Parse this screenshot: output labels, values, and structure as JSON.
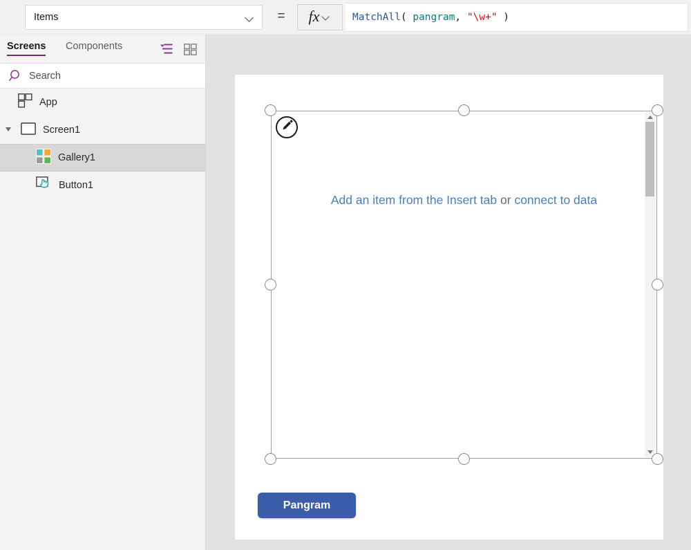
{
  "formula_bar": {
    "property_selector": {
      "value": "Items",
      "chevron_icon": "chevron-down-icon"
    },
    "equals": "=",
    "fx_button": {
      "glyph": "fx",
      "chevron_icon": "chevron-down-icon"
    },
    "formula": {
      "full_text": "MatchAll( pangram, \"\\w+\" )",
      "tokens": [
        {
          "text": "MatchAll",
          "type": "function"
        },
        {
          "text": "( ",
          "type": "punct"
        },
        {
          "text": "pangram",
          "type": "identifier"
        },
        {
          "text": ", ",
          "type": "punct"
        },
        {
          "text": "\"",
          "type": "string"
        },
        {
          "text": "\\w",
          "type": "escape"
        },
        {
          "text": "+\"",
          "type": "string"
        },
        {
          "text": " )",
          "type": "punct"
        }
      ]
    }
  },
  "left_panel": {
    "tabs": [
      {
        "label": "Screens",
        "active": true
      },
      {
        "label": "Components",
        "active": false
      }
    ],
    "view_icons": [
      {
        "name": "tree-view-icon",
        "color": "#8a3a8a"
      },
      {
        "name": "grid-view-icon",
        "color": "#8e8e8e"
      }
    ],
    "search": {
      "placeholder": "Search",
      "value": "",
      "icon": "search-icon"
    },
    "tree_items": [
      {
        "label": "App",
        "icon": "app-icon",
        "indent": 28,
        "selected": false,
        "expander": false
      },
      {
        "label": "Screen1",
        "icon": "screen-icon",
        "indent": 30,
        "selected": false,
        "expander": true
      },
      {
        "label": "Gallery1",
        "icon": "gallery-icon",
        "indent": 52,
        "selected": true,
        "expander": false
      },
      {
        "label": "Button1",
        "icon": "button-icon",
        "indent": 52,
        "selected": false,
        "expander": false
      }
    ]
  },
  "canvas": {
    "gallery": {
      "placeholder_link_1": "Add an item from the Insert tab",
      "placeholder_or": " or ",
      "placeholder_link_2": "connect to data",
      "edit_badge_icon": "pencil-icon",
      "scrollbar": {
        "up_icon": "scroll-up-arrow-icon",
        "down_icon": "scroll-down-arrow-icon"
      }
    },
    "button": {
      "label": "Pangram"
    }
  },
  "colors": {
    "accent_purple": "#742774",
    "link_blue": "#4a7ebb",
    "button_blue": "#3b5ca8",
    "selection_gray": "#d7d7d7",
    "stage_gray": "#e2e2e2"
  }
}
